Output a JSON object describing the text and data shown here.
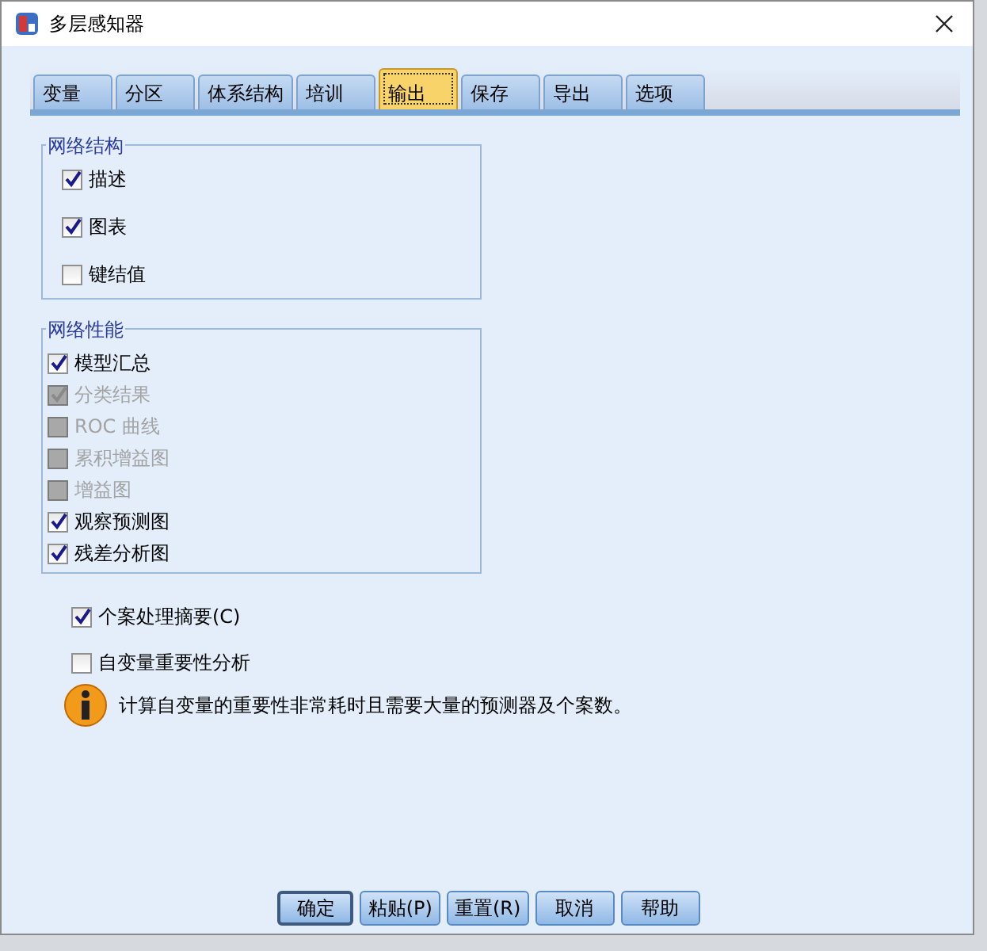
{
  "window": {
    "title": "多层感知器"
  },
  "tabs": [
    {
      "label": "变量",
      "selected": false
    },
    {
      "label": "分区",
      "selected": false
    },
    {
      "label": "体系结构",
      "selected": false
    },
    {
      "label": "培训",
      "selected": false
    },
    {
      "label": "输出",
      "selected": true
    },
    {
      "label": "保存",
      "selected": false
    },
    {
      "label": "导出",
      "selected": false
    },
    {
      "label": "选项",
      "selected": false
    }
  ],
  "groups": [
    {
      "title": "网络结构",
      "items": [
        {
          "label": "描述",
          "checked": true,
          "disabled": false
        },
        {
          "label": "图表",
          "checked": true,
          "disabled": false
        },
        {
          "label": "键结值",
          "checked": false,
          "disabled": false
        }
      ]
    },
    {
      "title": "网络性能",
      "items": [
        {
          "label": "模型汇总",
          "checked": true,
          "disabled": false
        },
        {
          "label": "分类结果",
          "checked": true,
          "disabled": true
        },
        {
          "label": "ROC 曲线",
          "checked": false,
          "disabled": true
        },
        {
          "label": "累积增益图",
          "checked": false,
          "disabled": true
        },
        {
          "label": "增益图",
          "checked": false,
          "disabled": true
        },
        {
          "label": "观察预测图",
          "checked": true,
          "disabled": false
        },
        {
          "label": "残差分析图",
          "checked": true,
          "disabled": false
        }
      ]
    }
  ],
  "options": [
    {
      "label": "个案处理摘要(C)",
      "checked": true
    },
    {
      "label": "自变量重要性分析",
      "checked": false
    }
  ],
  "info": {
    "text": "计算自变量的重要性非常耗时且需要大量的预测器及个案数。"
  },
  "buttons": [
    {
      "label": "确定",
      "selected": true
    },
    {
      "label": "粘贴(P)",
      "selected": false
    },
    {
      "label": "重置(R)",
      "selected": false
    },
    {
      "label": "取消",
      "selected": false
    },
    {
      "label": "帮助",
      "selected": false
    }
  ]
}
